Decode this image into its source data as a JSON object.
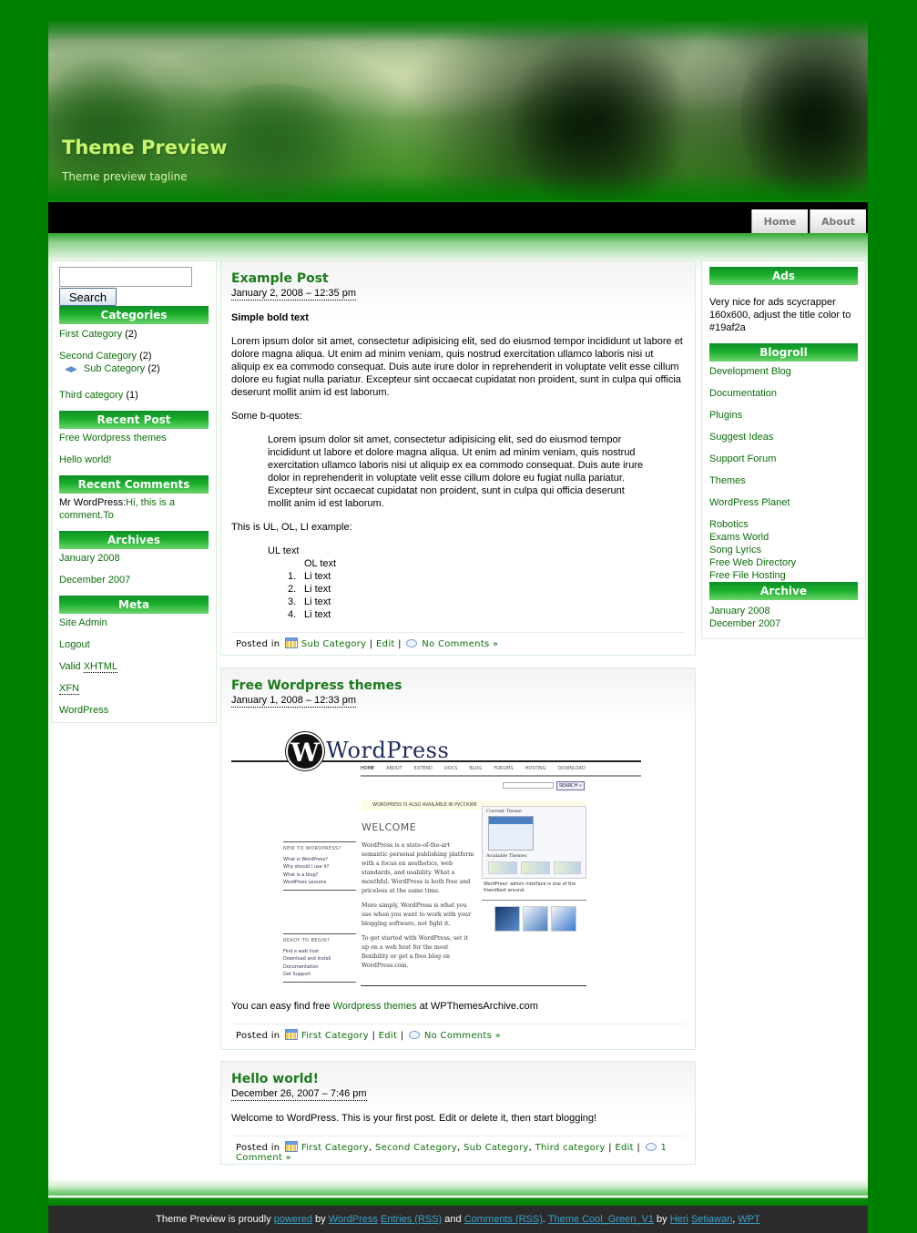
{
  "site": {
    "title": "Theme Preview",
    "tagline": "Theme preview tagline"
  },
  "nav": {
    "items": [
      {
        "label": "Home"
      },
      {
        "label": "About"
      }
    ]
  },
  "colors": {
    "page_bg": "#008000",
    "widget_title": "#19af2a",
    "link": "#0b6e0b",
    "post_title": "#1b7a1b",
    "footer_bg": "#2b2b2b",
    "footer_link": "#3aa0c8"
  },
  "left_sidebar": {
    "search": {
      "value": "",
      "placeholder": "",
      "button": "Search"
    },
    "categories": {
      "title": "Categories",
      "items": [
        {
          "label": "First Category",
          "count": "(2)"
        },
        {
          "label": "Second Category",
          "count": "(2)"
        },
        {
          "label": "Sub Category",
          "count": "(2)",
          "icon": "arrows-icon"
        },
        {
          "label": "Third category",
          "count": "(1)"
        }
      ]
    },
    "recent_posts": {
      "title": "Recent Post",
      "items": [
        "Free Wordpress themes",
        "Hello world!"
      ]
    },
    "recent_comments": {
      "title": "Recent Comments",
      "author": "Mr WordPress",
      "separator": ":",
      "link": "Hi, this is a comment.To"
    },
    "archives": {
      "title": "Archives",
      "items": [
        "January 2008",
        "December 2007"
      ]
    },
    "meta": {
      "title": "Meta",
      "site_admin": "Site Admin",
      "logout": "Logout",
      "valid_prefix": "Valid ",
      "valid_abbr": "XHTML",
      "xfn": "XFN",
      "wordpress": "WordPress"
    }
  },
  "right_sidebar": {
    "ads": {
      "title": "Ads",
      "text": "Very nice for ads scycrapper 160x600, adjust the title color to #19af2a"
    },
    "blogroll": {
      "title": "Blogroll",
      "items": [
        "Development Blog",
        "Documentation",
        "Plugins",
        "Suggest Ideas",
        "Support Forum",
        "Themes",
        "WordPress Planet"
      ],
      "extra_items": [
        "Robotics",
        "Exams World",
        "Song Lyrics",
        "Free Web Directory",
        "Free File Hosting"
      ]
    },
    "archive": {
      "title": "Archive",
      "items": [
        "January 2008",
        "December 2007"
      ]
    }
  },
  "posts": [
    {
      "title": "Example Post",
      "date": "January 2, 2008 – 12:35 pm",
      "bold": "Simple bold text",
      "paragraph": "Lorem ipsum dolor sit amet, consectetur adipisicing elit, sed do eiusmod tempor incididunt ut labore et dolore magna aliqua. Ut enim ad minim veniam, quis nostrud exercitation ullamco laboris nisi ut aliquip ex ea commodo consequat. Duis aute irure dolor in reprehenderit in voluptate velit esse cillum dolore eu fugiat nulla pariatur. Excepteur sint occaecat cupidatat non proident, sunt in culpa qui officia deserunt mollit anim id est laborum.",
      "bquote_label": "Some b-quotes:",
      "blockquote": "Lorem ipsum dolor sit amet, consectetur adipisicing elit, sed do eiusmod tempor incididunt ut labore et dolore magna aliqua. Ut enim ad minim veniam, quis nostrud exercitation ullamco laboris nisi ut aliquip ex ea commodo consequat. Duis aute irure dolor in reprehenderit in voluptate velit esse cillum dolore eu fugiat nulla pariatur. Excepteur sint occaecat cupidatat non proident, sunt in culpa qui officia deserunt mollit anim id est laborum.",
      "list_label": "This is UL, OL, LI example:",
      "ul_text": "UL text",
      "ol_text": "OL text",
      "li_items": [
        {
          "num": "1.",
          "text": "Li text"
        },
        {
          "num": "2.",
          "text": "Li text"
        },
        {
          "num": "3.",
          "text": "Li text"
        },
        {
          "num": "4.",
          "text": "Li text"
        }
      ],
      "meta": {
        "posted_in": "Posted in",
        "categories": [
          "Sub Category"
        ],
        "edit": "Edit",
        "comments": "No Comments »"
      }
    },
    {
      "title": "Free Wordpress themes",
      "date": "January 1, 2008 – 12:33 pm",
      "screenshot": {
        "logo_letter": "W",
        "logo_text": "WordPress",
        "nav": [
          "HOME",
          "ABOUT",
          "EXTEND",
          "DOCS",
          "BLOG",
          "FORUMS",
          "HOSTING",
          "DOWNLOAD"
        ],
        "search_button": "SEARCH »",
        "banner": "WORDPRESS IS ALSO AVAILABLE IN РУССКИЙ.",
        "welcome": "WELCOME",
        "new_heading": "NEW TO WORDPRESS?",
        "new_links": [
          "What is WordPress?",
          "Why should I use it?",
          "What is a blog?",
          "WordPress Lessons"
        ],
        "ready_heading": "READY TO BEGIN?",
        "ready_links": [
          "Find a web host",
          "Download and Install",
          "Documentation",
          "Get Support"
        ],
        "para1": "WordPress is a state-of-the-art semantic personal publishing platform with a focus on aesthetics, web standards, and usability. What a mouthful. WordPress is both free and priceless at the same time.",
        "para2": "More simply, WordPress is what you use when you want to work with your blogging software, not fight it.",
        "para3": "To get started with WordPress, set it up on a web host for the most flexibility or get a free blog on WordPress.com.",
        "current_theme": "Current Theme",
        "available_themes": "Available Themes",
        "caption": "WordPress' admin interface is one of the friendliest around."
      },
      "text_before": "You can easy find free ",
      "text_link": "Wordpress themes",
      "text_after": " at WPThemesArchive.com",
      "meta": {
        "posted_in": "Posted in",
        "categories": [
          "First Category"
        ],
        "edit": "Edit",
        "comments": "No Comments »"
      }
    },
    {
      "title": "Hello world!",
      "date": "December 26, 2007 – 7:46 pm",
      "text": "Welcome to WordPress. This is your first post. Edit or delete it, then start blogging!",
      "meta": {
        "posted_in": "Posted in",
        "categories": [
          "First Category",
          "Second Category",
          "Sub Category",
          "Third category"
        ],
        "edit": "Edit",
        "comments": "1 Comment »"
      }
    }
  ],
  "footer": {
    "t1": "Theme Preview is proudly ",
    "l_powered": "powered",
    "t2": " by ",
    "l_wordpress": "WordPress",
    "t3": " ",
    "l_entries": "Entries (RSS)",
    "t4": " and ",
    "l_comments": "Comments (RSS)",
    "t5": ". ",
    "l_theme": "Theme Cool_Green_V1",
    "t6": " by ",
    "l_heri": "Heri",
    "t7": " ",
    "l_setiawan": "Setiawan",
    "t8": ", ",
    "l_wpt": "WPT"
  }
}
